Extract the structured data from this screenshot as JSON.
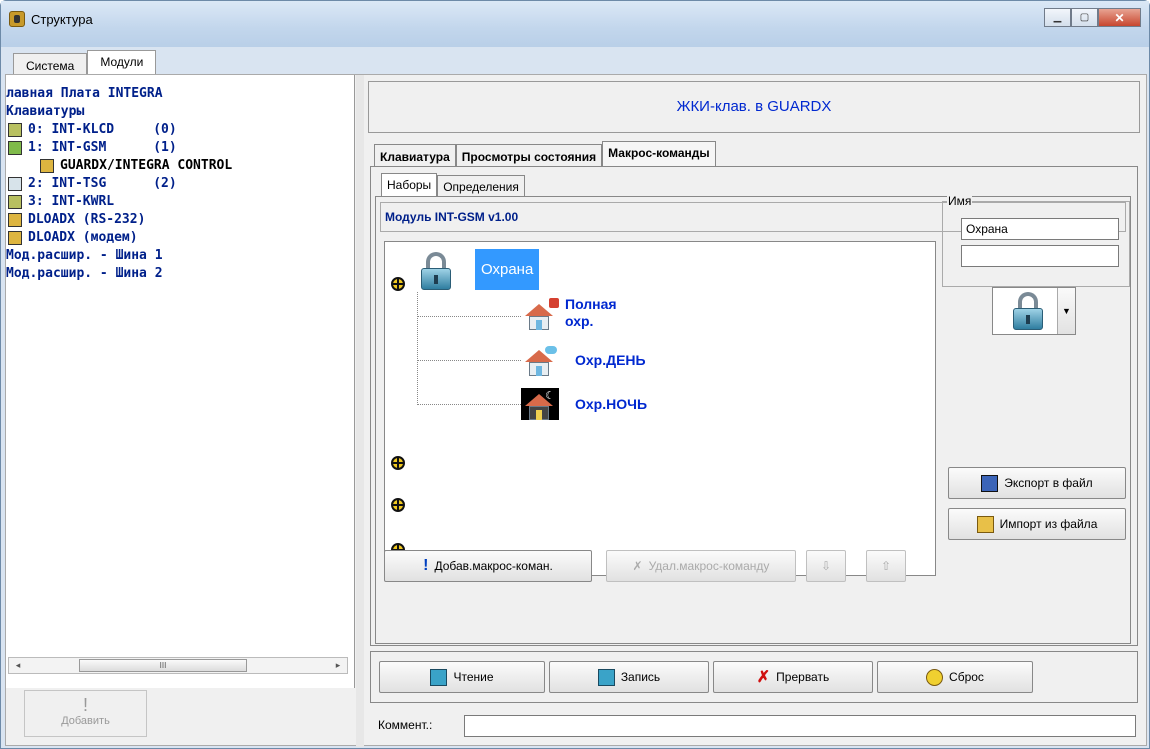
{
  "window": {
    "title": "Структура"
  },
  "top_tabs": [
    "Система",
    "Модули"
  ],
  "tree": {
    "items": [
      "лавная Плата INTEGRA",
      "Клавиатуры",
      "0: INT-KLCD     (0)",
      "1: INT-GSM      (1)",
      "GUARDX/INTEGRA CONTROL",
      "2: INT-TSG      (2)",
      "3: INT-KWRL",
      "DLOADX (RS-232)",
      "DLOADX (модем)",
      "Мод.расшир. - Шина 1",
      "Мод.расшир. - Шина 2"
    ],
    "scroll_thumb": "III"
  },
  "left_add_button": "Добавить",
  "header_title": "ЖКИ-клав. в GUARDX",
  "right_tabs": [
    "Клавиатура",
    "Просмотры состояния",
    "Макрос-команды"
  ],
  "sub_tabs": [
    "Наборы",
    "Определения"
  ],
  "module_title": "Модуль INT-GSM v1.00",
  "macro_group": {
    "name": "Охрана",
    "items": [
      {
        "label_line1": "Полная",
        "label_line2": "охр."
      },
      {
        "label_line1": "Охр.ДЕНЬ"
      },
      {
        "label_line1": "Охр.НОЧЬ"
      }
    ]
  },
  "name_panel": {
    "legend": "Имя",
    "name_value": "Охрана",
    "name_value2": ""
  },
  "buttons": {
    "add_macro": "Добав.макрос-коман.",
    "delete_macro": "Удал.макрос-команду",
    "down": "⇩",
    "up": "⇧",
    "export": "Экспорт в файл",
    "import": "Импорт из файла",
    "read": "Чтение",
    "write": "Запись",
    "abort": "Прервать",
    "reset": "Сброс"
  },
  "comment_label": "Коммент.:",
  "comment_value": "",
  "colors": {
    "accent_blue": "#0028d0",
    "selection": "#3399ff",
    "tree_text": "#00208a"
  }
}
